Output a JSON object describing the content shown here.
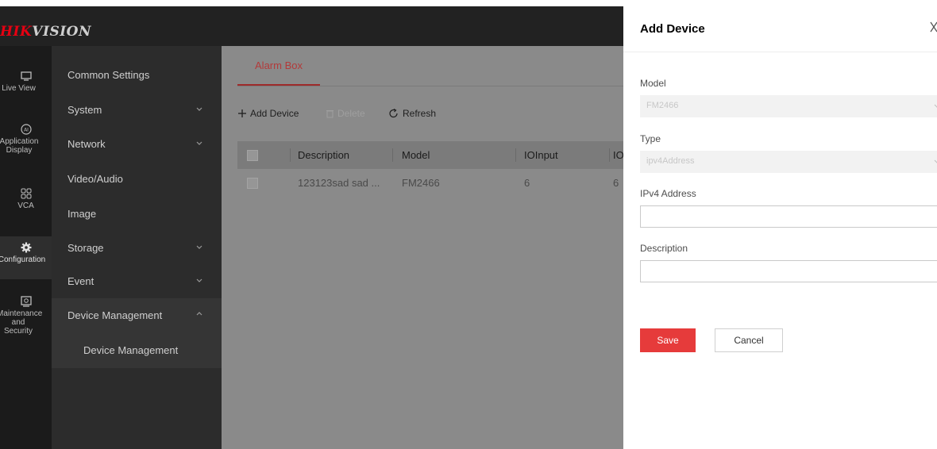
{
  "brand": {
    "logo_red": "HIK",
    "logo_grey": "VISION"
  },
  "rail": [
    {
      "label": "Live View",
      "icon": "monitor-icon"
    },
    {
      "label": "Application Display",
      "icon": "ai-icon"
    },
    {
      "label": "VCA",
      "icon": "grid-icon"
    },
    {
      "label": "Configuration",
      "icon": "gear-icon",
      "active": true
    },
    {
      "label": "Maintenance and Security",
      "icon": "maintenance-icon"
    }
  ],
  "menu": {
    "common": "Common Settings",
    "system": "System",
    "network": "Network",
    "video_audio": "Video/Audio",
    "image": "Image",
    "storage": "Storage",
    "event": "Event",
    "device_management": "Device Management",
    "device_management_sub": "Device Management"
  },
  "content": {
    "tab": "Alarm Box",
    "toolbar": {
      "add": "Add Device",
      "delete": "Delete",
      "refresh": "Refresh"
    },
    "columns": [
      "Description",
      "Model",
      "IOInput",
      "IO"
    ],
    "rows": [
      {
        "description": "123123sad sad ...",
        "model": "FM2466",
        "ioinput": "6",
        "io": "6"
      }
    ]
  },
  "drawer": {
    "title": "Add Device",
    "model_label": "Model",
    "model_value": "FM2466",
    "type_label": "Type",
    "type_value": "ipv4Address",
    "ipv4_label": "IPv4 Address",
    "ipv4_value": "",
    "description_label": "Description",
    "description_value": "",
    "save": "Save",
    "cancel": "Cancel"
  },
  "colors": {
    "accent": "#e63b3b",
    "brand_red": "#e60012",
    "rail_bg": "#1b1b1b",
    "menu_bg": "#2c2c2c"
  }
}
